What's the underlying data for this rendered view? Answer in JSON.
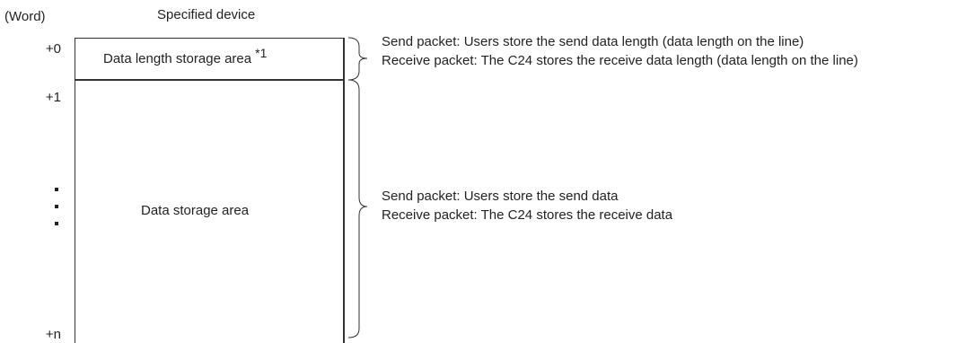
{
  "header": {
    "unit": "(Word)",
    "device_title": "Specified device"
  },
  "offsets": {
    "first": "+0",
    "second": "+1",
    "last": "+n"
  },
  "areas": {
    "length_area": "Data length storage area",
    "length_note_mark": "*1",
    "data_area": "Data storage area"
  },
  "descriptions": {
    "length": {
      "send": "Send packet: Users store the send data length (data length on the line)",
      "receive": "Receive packet: The C24 stores the receive data length (data length on the line)"
    },
    "data": {
      "send": "Send packet: Users store the send data",
      "receive": "Receive packet: The C24 stores the receive data"
    }
  }
}
